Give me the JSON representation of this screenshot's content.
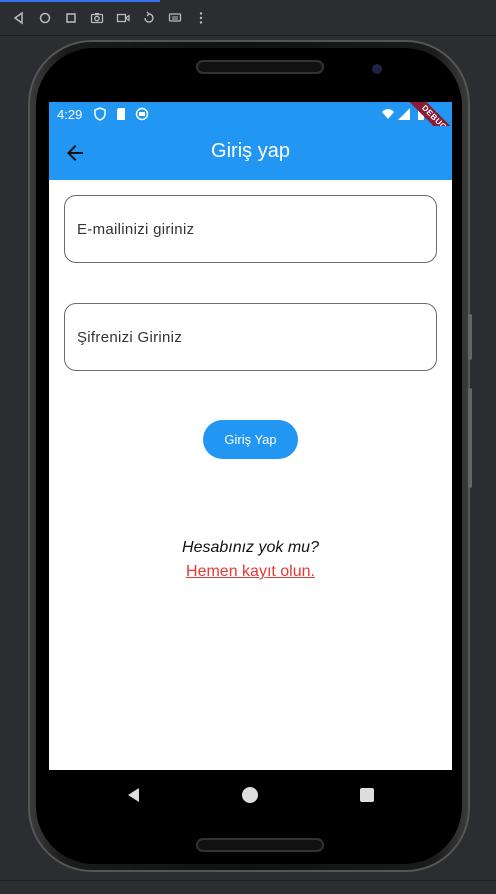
{
  "status_bar": {
    "time": "4:29"
  },
  "app_bar": {
    "title": "Giriş yap",
    "debug_label": "DEBUG"
  },
  "form": {
    "email_placeholder": "E-mailinizi giriniz",
    "email_value": "",
    "password_placeholder": "Şifrenizi Giriniz",
    "password_value": "",
    "login_label": "Giriş Yap"
  },
  "register": {
    "question": "Hesabınız yok mu?",
    "link_label": "Hemen kayıt olun."
  },
  "icons": {
    "back": "arrow-back-icon",
    "nav_back": "triangle-back-icon",
    "nav_home": "circle-home-icon",
    "nav_recents": "square-recents-icon"
  },
  "colors": {
    "primary": "#2196f3",
    "link": "#e53935",
    "debug_ribbon": "#8b1c37"
  }
}
